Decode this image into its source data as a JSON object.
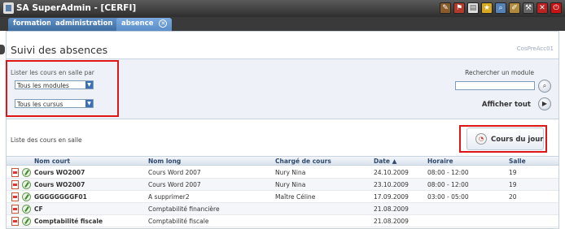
{
  "window": {
    "title": "SA SuperAdmin - [CERFI]",
    "toolbar_icons": [
      "wrench-icon",
      "flag-icon",
      "document-icon",
      "star-icon",
      "search-icon",
      "edit-icon",
      "tools-icon",
      "close-icon",
      "power-icon"
    ]
  },
  "tabs": [
    {
      "label": "formation",
      "closable": false,
      "active": false
    },
    {
      "label": "administration",
      "closable": true,
      "active": false
    },
    {
      "label": "absence",
      "closable": true,
      "active": true
    }
  ],
  "page": {
    "title": "Suivi des absences",
    "code": "CosPreAcc01"
  },
  "filters": {
    "label": "Lister les cours en salle par",
    "module_select": "Tous les modules",
    "cursus_select": "Tous les cursus"
  },
  "search": {
    "label": "Rechercher un module",
    "value": "",
    "show_all_label": "Afficher tout"
  },
  "list": {
    "label": "Liste des cours en salle",
    "today_button": "Cours du jour",
    "sort_indicator": "▲",
    "columns": [
      "Nom court",
      "Nom long",
      "Chargé de cours",
      "Date",
      "Horaire",
      "Salle"
    ],
    "rows": [
      {
        "short": "Cours WO2007",
        "long": "Cours Word 2007",
        "teacher": "Nury Nina",
        "date": "24.10.2009",
        "time": "08:00 - 12:00",
        "room": "19"
      },
      {
        "short": "Cours WO2007",
        "long": "Cours Word 2007",
        "teacher": "Nury Nina",
        "date": "23.10.2009",
        "time": "08:00 - 12:00",
        "room": "19"
      },
      {
        "short": "GGGGGGGGF01",
        "long": "A supprimer2",
        "teacher": "Maître Céline",
        "date": "17.09.2009",
        "time": "03:00 - 05:00",
        "room": "20"
      },
      {
        "short": "CF",
        "long": "Comptabilité financière",
        "teacher": "",
        "date": "21.08.2009",
        "time": "",
        "room": ""
      },
      {
        "short": "Comptabilité fiscale",
        "long": "Comptabilité fiscale",
        "teacher": "",
        "date": "21.08.2009",
        "time": "",
        "room": ""
      }
    ]
  },
  "colors": {
    "tab_blue": "#5c8fca",
    "highlight_red": "#e01515",
    "panel_bg": "#eef2f8"
  }
}
